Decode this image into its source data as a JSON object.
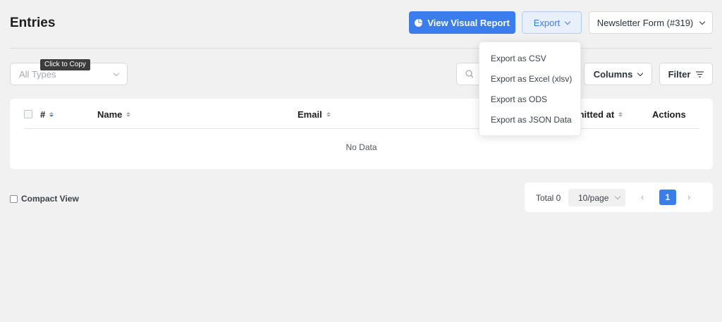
{
  "header": {
    "title": "Entries",
    "visual_report_label": "View Visual Report",
    "export_label": "Export",
    "form_selector_label": "Newsletter Form (#319)"
  },
  "tooltip": {
    "text": "Click to Copy"
  },
  "filters": {
    "types_placeholder": "All Types",
    "columns_label": "Columns",
    "filter_label": "Filter"
  },
  "export_menu": {
    "items": [
      "Export as CSV",
      "Export as Excel (xlsv)",
      "Export as ODS",
      "Export as JSON Data"
    ]
  },
  "table": {
    "columns": [
      "#",
      "Name",
      "Email",
      "mitted at",
      "Actions"
    ],
    "empty_text": "No Data"
  },
  "footer": {
    "compact_view_label": "Compact View",
    "total_label": "Total 0",
    "page_size": "10/page",
    "prev_symbol": "‹",
    "current_page": "1",
    "next_symbol": "›"
  },
  "colors": {
    "primary": "#3b7ded",
    "background": "#f1f1f1",
    "card": "#ffffff"
  }
}
